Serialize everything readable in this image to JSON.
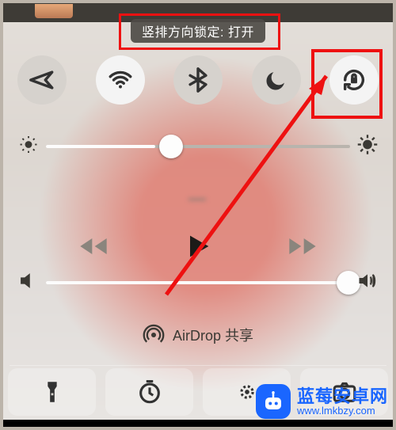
{
  "banner": {
    "text": "竖排方向锁定: 打开"
  },
  "toggles": [
    {
      "name": "airplane-mode-toggle",
      "icon": "airplane-icon",
      "active": false
    },
    {
      "name": "wifi-toggle",
      "icon": "wifi-icon",
      "active": true
    },
    {
      "name": "bluetooth-toggle",
      "icon": "bluetooth-icon",
      "active": false
    },
    {
      "name": "do-not-disturb-toggle",
      "icon": "moon-icon",
      "active": false
    },
    {
      "name": "orientation-lock-toggle",
      "icon": "orientation-lock-icon",
      "active": true
    }
  ],
  "brightness": {
    "value": 0.35
  },
  "now_playing": {
    "title": "—"
  },
  "transport": {
    "prev": "rewind-icon",
    "play": "play-icon",
    "next": "fast-forward-icon"
  },
  "volume": {
    "value": 0.92
  },
  "airdrop": {
    "label": "AirDrop 共享",
    "icon": "airdrop-icon"
  },
  "bottom": [
    {
      "name": "flashlight-shortcut",
      "icon": "flashlight-icon"
    },
    {
      "name": "timer-shortcut",
      "icon": "timer-icon"
    },
    {
      "name": "night-shift-shortcut",
      "icon": "night-shift-icon"
    },
    {
      "name": "camera-shortcut",
      "icon": "camera-icon"
    }
  ],
  "watermark": {
    "line1": "蓝莓安卓网",
    "line2": "www.lmkbzy.com"
  },
  "annotation": {
    "color": "#e11",
    "highlight_banner": true,
    "highlight_orientation_lock": true,
    "arrow_from": "airdrop-row",
    "arrow_to": "orientation-lock-toggle"
  }
}
